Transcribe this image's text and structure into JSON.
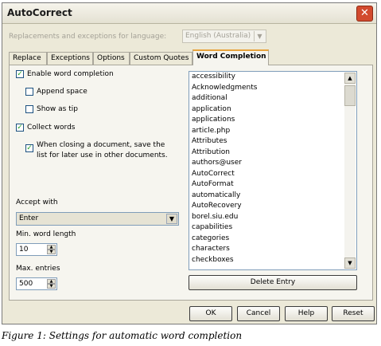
{
  "window": {
    "title": "AutoCorrect",
    "close_glyph": "✕"
  },
  "language": {
    "label": "Replacements and exceptions for language:",
    "value": "English (Australia)"
  },
  "tabs": [
    "Replace",
    "Exceptions",
    "Options",
    "Custom Quotes",
    "Word Completion"
  ],
  "active_tab": "Word Completion",
  "options": {
    "enable_word_completion": {
      "label": "Enable word completion",
      "checked": true
    },
    "append_space": {
      "label": "Append space",
      "checked": false
    },
    "show_as_tip": {
      "label": "Show as tip",
      "checked": false
    },
    "collect_words": {
      "label": "Collect words",
      "checked": true
    },
    "save_list": {
      "label_line1": "When closing a document, save the",
      "label_line2": "list for later use in other documents.",
      "checked": true
    }
  },
  "accept_with": {
    "label": "Accept with",
    "value": "Enter"
  },
  "min_word_length": {
    "label": "Min. word length",
    "value": "10"
  },
  "max_entries": {
    "label": "Max. entries",
    "value": "500"
  },
  "word_list": [
    "accessibility",
    "Acknowledgments",
    "additional",
    "application",
    "applications",
    "article.php",
    "Attributes",
    "Attribution",
    "authors@user",
    "AutoCorrect",
    "AutoFormat",
    "automatically",
    "AutoRecovery",
    "borel.siu.edu",
    "capabilities",
    "categories",
    "characters",
    "checkboxes"
  ],
  "delete_entry_label": "Delete Entry",
  "buttons": {
    "ok": "OK",
    "cancel": "Cancel",
    "help": "Help",
    "reset": "Reset"
  },
  "caption": "Figure 1: Settings for automatic word completion",
  "colors": {
    "checkmark": "#21a121",
    "active_tab_accent": "#e8a33c",
    "close_button": "#d24a2e"
  }
}
